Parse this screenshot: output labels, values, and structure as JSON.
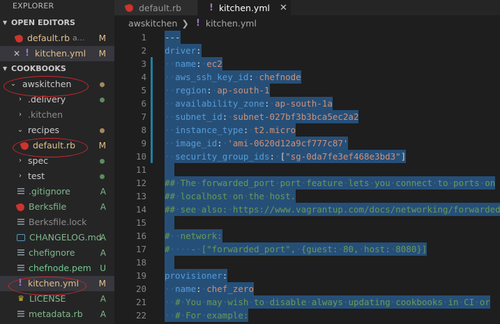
{
  "sidebar": {
    "title": "EXPLORER",
    "open_editors_header": "OPEN EDITORS",
    "open_editors": [
      {
        "label": "default.rb",
        "desc": "a...",
        "status": "M"
      },
      {
        "label": "kitchen.yml",
        "status": "M"
      }
    ],
    "cookbooks_header": "COOKBOOKS",
    "tree": [
      {
        "label": "awskitchen"
      },
      {
        "label": ".delivery"
      },
      {
        "label": ".kitchen"
      },
      {
        "label": "recipes"
      },
      {
        "label": "default.rb",
        "status": "M"
      },
      {
        "label": "spec"
      },
      {
        "label": "test"
      },
      {
        "label": ".gitignore",
        "status": "A"
      },
      {
        "label": "Berksfile",
        "status": "A"
      },
      {
        "label": "Berksfile.lock"
      },
      {
        "label": "CHANGELOG.md",
        "status": "A"
      },
      {
        "label": "chefignore",
        "status": "A"
      },
      {
        "label": "chefnode.pem",
        "status": "U"
      },
      {
        "label": "kitchen.yml",
        "status": "M"
      },
      {
        "label": "LICENSE",
        "status": "A"
      },
      {
        "label": "metadata.rb",
        "status": "A"
      }
    ]
  },
  "tabs": [
    {
      "label": "default.rb"
    },
    {
      "label": "kitchen.yml",
      "close": "✕"
    }
  ],
  "breadcrumb": {
    "folder": "awskitchen",
    "sep": "❯",
    "file": "kitchen.yml"
  },
  "editor": {
    "lines": [
      {
        "n": "1",
        "text": "---"
      },
      {
        "n": "2",
        "text": "driver:"
      },
      {
        "n": "3",
        "text": "  name: ec2"
      },
      {
        "n": "4",
        "text": "  aws_ssh_key_id: chefnode"
      },
      {
        "n": "5",
        "text": "  region: ap-south-1"
      },
      {
        "n": "6",
        "text": "  availability_zone: ap-south-1a"
      },
      {
        "n": "7",
        "text": "  subnet_id: subnet-027bf3b3bca5ec2a2"
      },
      {
        "n": "8",
        "text": "  instance_type: t2.micro"
      },
      {
        "n": "9",
        "text": "  image_id: 'ami-0620d12a9cf777c87'"
      },
      {
        "n": "10",
        "text": "  security_group_ids: [\"sg-0da7fe3ef468e3bd3\"]"
      },
      {
        "n": "11",
        "text": ""
      },
      {
        "n": "12",
        "text": "## The forwarded_port port feature lets you connect to ports on"
      },
      {
        "n": "13",
        "text": "## localhost on the host."
      },
      {
        "n": "14",
        "text": "## see also: https://www.vagrantup.com/docs/networking/forwarded"
      },
      {
        "n": "15",
        "text": ""
      },
      {
        "n": "16",
        "text": "#  network:"
      },
      {
        "n": "17",
        "text": "#    - [\"forwarded_port\", {guest: 80, host: 8080}]"
      },
      {
        "n": "18",
        "text": ""
      },
      {
        "n": "19",
        "text": "provisioner:"
      },
      {
        "n": "20",
        "text": "  name: chef_zero"
      },
      {
        "n": "21",
        "text": "  # You may wish to disable always updating cookbooks in CI or"
      },
      {
        "n": "22",
        "text": "  # For example:"
      }
    ]
  },
  "colors": {
    "accent_modified": "#e2c08d",
    "accent_added": "#81b88b",
    "selection": "#264f78",
    "annotation_red": "#d4262b"
  }
}
